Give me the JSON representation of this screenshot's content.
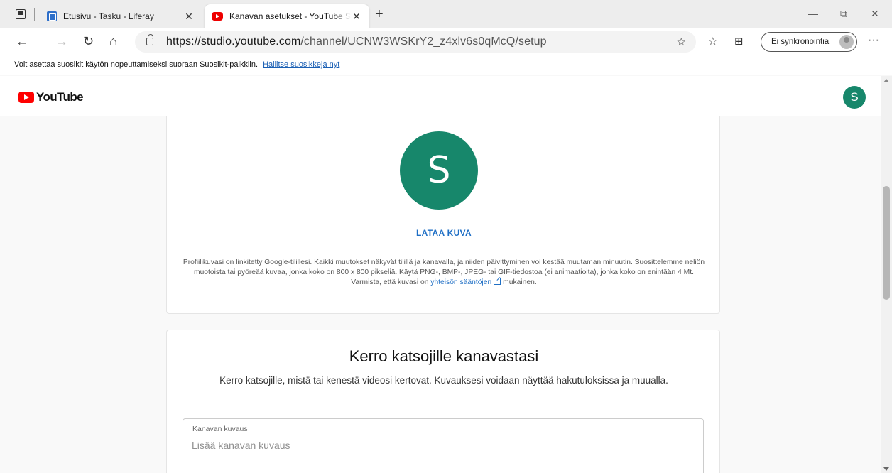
{
  "browser": {
    "tabs": [
      {
        "title": "Etusivu - Tasku - Liferay",
        "favicon": "liferay-icon"
      },
      {
        "title": "Kanavan asetukset - YouTube Studio",
        "favicon": "youtube-icon"
      }
    ],
    "new_tab_glyph": "+",
    "tab_close_glyph": "✕",
    "window_controls": {
      "minimize": "—",
      "restore": "⧉",
      "close": "✕"
    },
    "nav": {
      "back": "←",
      "forward": "→",
      "refresh": "↻",
      "home": "⌂"
    },
    "address": {
      "host": "https://studio.youtube.com",
      "path": "/channel/UCNW3WSKrY2_z4xlv6s0qMcQ/setup"
    },
    "toolbar_icons": {
      "add_favorite": "☆",
      "favorites": "☆",
      "collections": "⊞"
    },
    "sync_label": "Ei synkronointia",
    "more_glyph": "···"
  },
  "favorites_bar": {
    "message": "Voit asettaa suosikit käytön nopeuttamiseksi suoraan Suosikit-palkkiin.",
    "link": "Hallitse suosikkeja nyt"
  },
  "header": {
    "logo_text": "YouTube",
    "avatar_letter": "S"
  },
  "profile_card": {
    "avatar_letter": "S",
    "upload_label": "LATAA KUVA",
    "info_text": "Profiilikuvasi on linkitetty Google-tilillesi. Kaikki muutokset näkyvät tilillä ja kanavalla, ja niiden päivittyminen voi kestää muutaman minuutin. Suosittelemme neliön muotoista tai pyöreää kuvaa, jonka koko on 800 x 800 pikseliä. Käytä PNG-, BMP-, JPEG- tai GIF-tiedostoa (ei animaatioita), jonka koko on enintään 4 Mt. Varmista, että kuvasi on",
    "guidelines_link": "yhteisön sääntöjen",
    "info_suffix": "mukainen."
  },
  "about_card": {
    "title": "Kerro katsojille kanavastasi",
    "description": "Kerro katsojille, mistä tai kenestä videosi kertovat. Kuvauksesi voidaan näyttää hakutuloksissa ja muualla.",
    "field_label": "Kanavan kuvaus",
    "field_placeholder": "Lisää kanavan kuvaus",
    "field_value": ""
  },
  "colors": {
    "avatar_bg": "#17876b",
    "youtube_red": "#ff0000",
    "link_blue": "#1f6fc5"
  }
}
